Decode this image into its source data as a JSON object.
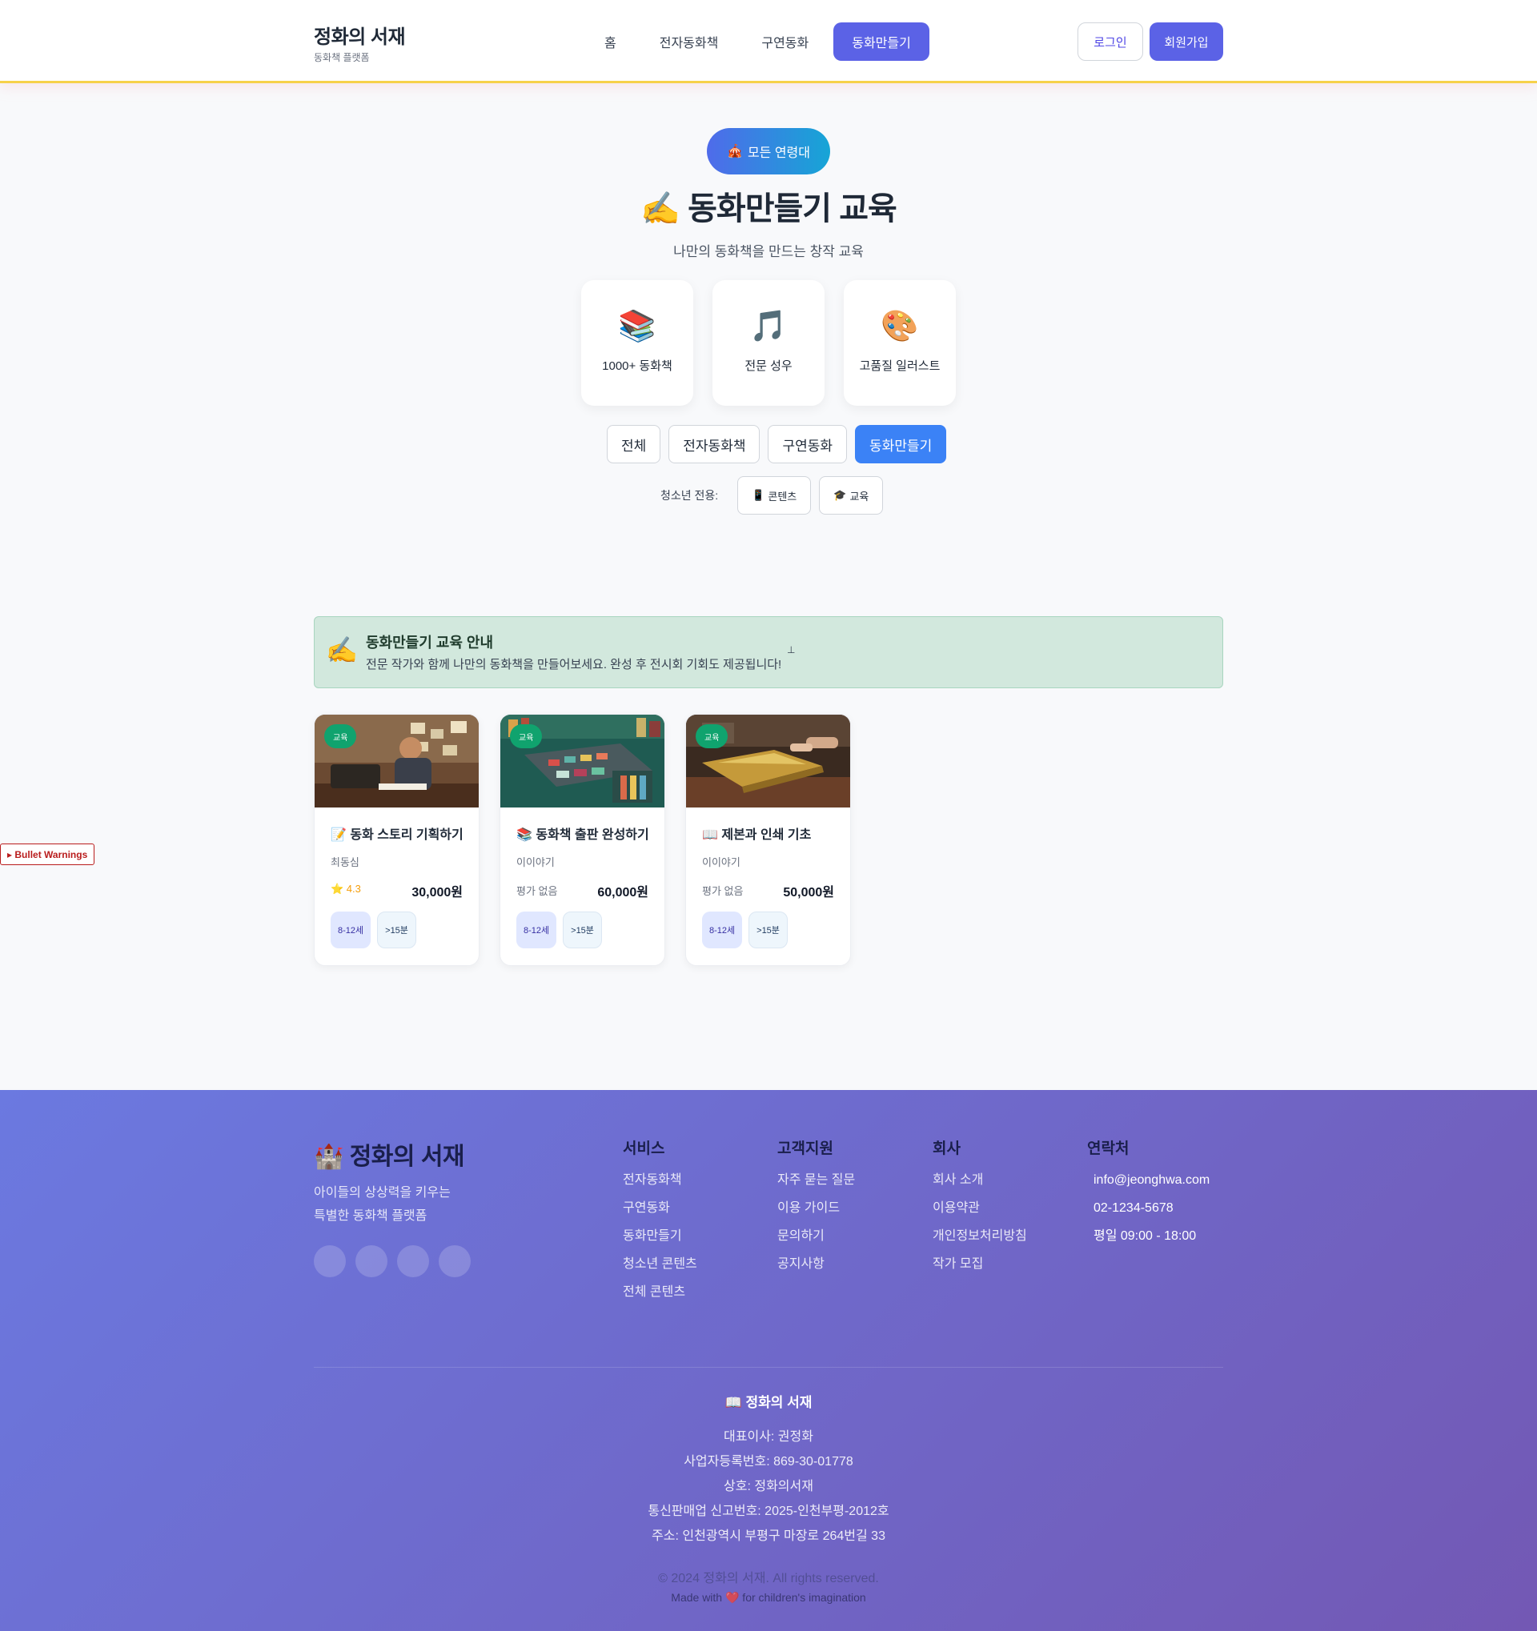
{
  "header": {
    "brand_title": "정화의 서재",
    "brand_sub": "동화책 플랫폼",
    "nav": [
      {
        "label": "홈",
        "active": false
      },
      {
        "label": "전자동화책",
        "active": false
      },
      {
        "label": "구연동화",
        "active": false
      },
      {
        "label": "동화만들기",
        "active": true
      }
    ],
    "login": "로그인",
    "signup": "회원가입"
  },
  "hero": {
    "age_icon": "🎪",
    "age_label": "모든 연령대",
    "title": "✍️ 동화만들기 교육",
    "subtitle": "나만의 동화책을 만드는 창작 교육",
    "features": [
      {
        "icon": "📚",
        "label": "1000+ 동화책"
      },
      {
        "icon": "🎵",
        "label": "전문 성우"
      },
      {
        "icon": "🎨",
        "label": "고품질 일러스트"
      }
    ]
  },
  "filters": {
    "items": [
      "전체",
      "전자동화책",
      "구연동화",
      "동화만들기"
    ],
    "active_index": 3,
    "youth_label": "청소년 전용:",
    "youth_items": [
      {
        "icon": "📱",
        "label": "콘텐츠"
      },
      {
        "icon": "🎓",
        "label": "교육"
      }
    ]
  },
  "notice": {
    "icon": "✍️",
    "title": "동화만들기 교육 안내",
    "text": "전문 작가와 함께 나만의 동화책을 만들어보세요. 완성 후 전시회 기회도 제공됩니다!",
    "mark": "⊥"
  },
  "cards": [
    {
      "badge": "교육",
      "title": "📝 동화 스토리 기획하기",
      "author": "최동심",
      "rating": "⭐ 4.3",
      "has_rating": true,
      "price": "30,000원",
      "age": "8-12세",
      "time": ">15분"
    },
    {
      "badge": "교육",
      "title": "📚 동화책 출판 완성하기",
      "author": "이이야기",
      "rating": "평가 없음",
      "has_rating": false,
      "price": "60,000원",
      "age": "8-12세",
      "time": ">15분"
    },
    {
      "badge": "교육",
      "title": "📖 제본과 인쇄 기초",
      "author": "이이야기",
      "rating": "평가 없음",
      "has_rating": false,
      "price": "50,000원",
      "age": "8-12세",
      "time": ">15분"
    }
  ],
  "bullet_warnings": "▸ Bullet Warnings",
  "footer": {
    "brand": "🏰 정화의 서재",
    "desc_line1": "아이들의 상상력을 키우는",
    "desc_line2": "특별한 동화책 플랫폼",
    "columns": [
      {
        "title": "서비스",
        "links": [
          "전자동화책",
          "구연동화",
          "동화만들기",
          "청소년 콘텐츠",
          "전체 콘텐츠"
        ]
      },
      {
        "title": "고객지원",
        "links": [
          "자주 묻는 질문",
          "이용 가이드",
          "문의하기",
          "공지사항"
        ]
      },
      {
        "title": "회사",
        "links": [
          "회사 소개",
          "이용약관",
          "개인정보처리방침",
          "작가 모집"
        ]
      },
      {
        "title": "연락처",
        "links": [
          "info@jeonghwa.com",
          "02-1234-5678",
          "평일 09:00 - 18:00"
        ]
      }
    ],
    "company_title": "📖 정화의 서재",
    "company_lines": [
      "대표이사: 권정화",
      "사업자등록번호: 869-30-01778",
      "상호: 정화의서재",
      "통신판매업 신고번호: 2025-인천부평-2012호",
      "주소: 인천광역시 부평구 마장로 264번길 33"
    ],
    "copyright": "© 2024 정화의 서재. All rights reserved.",
    "made_with": "Made with ❤️ for children's imagination"
  },
  "colors": {
    "primary": "#5b62e6",
    "filter_active": "#3b82f6",
    "badge": "#10a36e",
    "notice_bg": "#d2e8dd",
    "header_border": "#f6d14a"
  }
}
